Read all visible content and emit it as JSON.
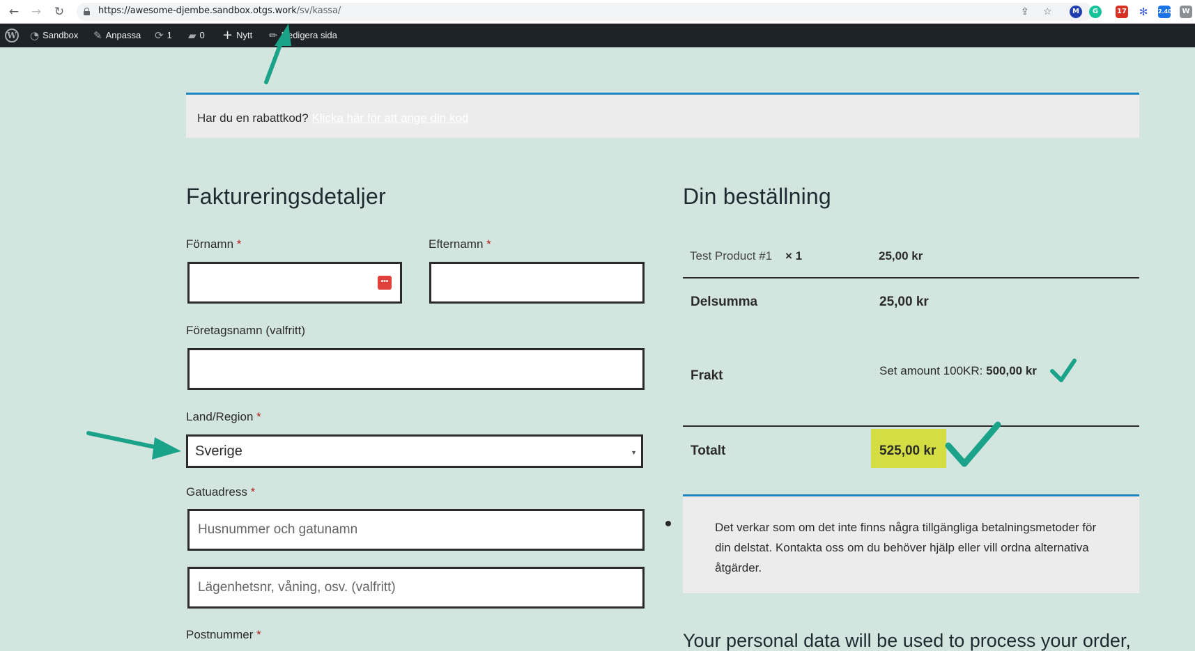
{
  "browser": {
    "url_host": "https://awesome-djembe.sandbox.otgs.work",
    "url_path": "/sv/kassa/",
    "ext_badges": {
      "calendar": "17",
      "download": "2.40"
    }
  },
  "adminbar": {
    "site": "Sandbox",
    "customize": "Anpassa",
    "updates": "1",
    "comments": "0",
    "new": "Nytt",
    "edit": "Redigera sida"
  },
  "coupon": {
    "question": "Har du en rabattkod?",
    "link": "Klicka här för att ange din kod"
  },
  "billing": {
    "title": "Faktureringsdetaljer",
    "first_name_label": "Förnamn",
    "last_name_label": "Efternamn",
    "company_label": "Företagsnamn (valfritt)",
    "country_label": "Land/Region",
    "country_value": "Sverige",
    "street_label": "Gatuadress",
    "street_placeholder": "Husnummer och gatunamn",
    "apartment_placeholder": "Lägenhetsnr, våning, osv. (valfritt)",
    "postcode_label": "Postnummer",
    "required_mark": "*"
  },
  "order": {
    "title": "Din beställning",
    "product_name": "Test Product #1",
    "product_qty": "× 1",
    "product_total": "25,00 kr",
    "subtotal_label": "Delsumma",
    "subtotal_value": "25,00 kr",
    "shipping_label": "Frakt",
    "shipping_method": "Set amount 100KR:",
    "shipping_value": "500,00 kr",
    "total_label": "Totalt",
    "total_value": "525,00 kr",
    "payment_notice": "Det verkar som om det inte finns några tillgängliga betalningsmetoder för din delstat. Kontakta oss om du behöver hjälp eller vill ordna alternativa åtgärder.",
    "privacy_text": "Your personal data will be used to process your order,"
  },
  "colors": {
    "page_bg": "#d3e5df",
    "notice_border": "#1e85be",
    "highlight": "#d4dd42",
    "annotation": "#1aa388"
  }
}
